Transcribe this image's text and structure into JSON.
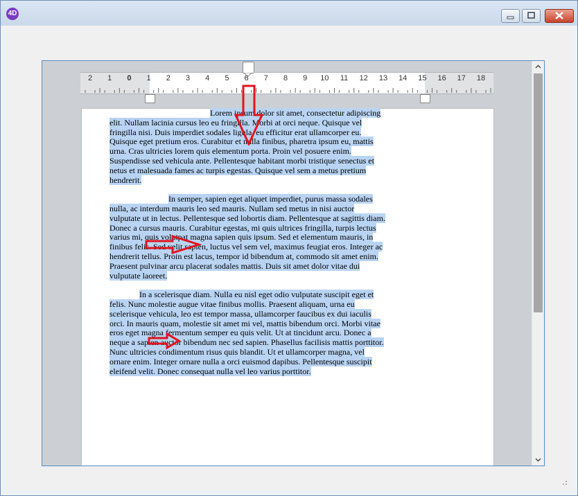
{
  "window": {
    "icon_label": "4D",
    "colors": {
      "selection": "#b9d4f3",
      "arrow": "#e0141e"
    }
  },
  "ruler": {
    "ticks": [
      "2",
      "1",
      "0",
      "1",
      "2",
      "3",
      "4",
      "5",
      "6",
      "7",
      "8",
      "9",
      "10",
      "11",
      "12",
      "13",
      "14",
      "15",
      "16",
      "17",
      "18"
    ]
  },
  "document": {
    "paragraphs": [
      "Lorem ipsum dolor sit amet, consectetur adipiscing elit. Nullam lacinia cursus leo eu fringilla. Morbi at orci neque. Quisque vel fringilla nisi. Duis imperdiet sodales ligula, eu efficitur erat ullamcorper eu. Quisque eget pretium eros. Curabitur et nulla finibus, pharetra ipsum eu, mattis urna. Cras ultricies lorem quis elementum porta. Proin vel posuere enim. Suspendisse sed vehicula ante. Pellentesque habitant morbi tristique senectus et netus et malesuada fames ac turpis egestas. Quisque vel sem a metus pretium hendrerit.",
      "In semper, sapien eget aliquet imperdiet, purus massa sodales nulla, ac interdum mauris leo sed mauris. Nullam sed metus in nisi auctor vulputate ut in lectus. Pellentesque sed lobortis diam. Pellentesque at sagittis diam. Donec a cursus mauris. Curabitur egestas, mi quis ultrices fringilla, turpis lectus varius mi, quis volutpat magna sapien quis ipsum. Sed et elementum mauris, in finibus felis. Sed velit sapien, luctus vel sem vel, maximus feugiat eros. Integer ac hendrerit tellus. Proin est lacus, tempor id bibendum at, commodo sit amet enim. Praesent pulvinar arcu placerat sodales mattis. Duis sit amet dolor vitae dui vulputate laoreet.",
      "In a scelerisque diam. Nulla eu nisl eget odio vulputate suscipit eget et felis. Nunc molestie augue vitae finibus mollis. Praesent aliquam, urna eu scelerisque vehicula, leo est tempor massa, ullamcorper faucibus ex dui iaculis orci. In mauris quam, molestie sit amet mi vel, mattis bibendum orci. Morbi vitae eros eget magna fermentum semper eu quis velit. Ut at tincidunt arcu. Donec a neque a sapien auctor bibendum nec sed sapien. Phasellus facilisis mattis porttitor. Nunc ultricies condimentum risus quis blandit. Ut et ullamcorper magna, vel ornare enim. Integer ornare nulla a orci euismod dapibus. Pellentesque suscipit eleifend velit. Donec consequat nulla vel leo varius porttitor."
    ]
  }
}
